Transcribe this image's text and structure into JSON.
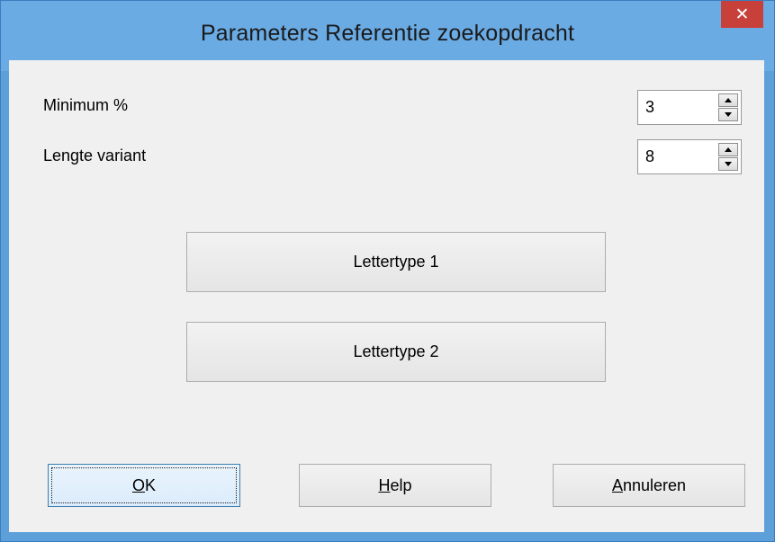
{
  "window": {
    "title": "Parameters Referentie zoekopdracht",
    "close_icon": "close-icon",
    "close_glyph": "✕",
    "accent_color": "#6aabe4",
    "close_color": "#c7403a"
  },
  "fields": {
    "minimum": {
      "label": "Minimum %",
      "value": "3"
    },
    "lengte": {
      "label": "Lengte variant",
      "value": "8"
    }
  },
  "font_buttons": {
    "font1": "Lettertype 1",
    "font2": "Lettertype 2"
  },
  "footer": {
    "ok": {
      "mnemonic": "O",
      "rest": "K"
    },
    "help": {
      "mnemonic": "H",
      "rest": "elp"
    },
    "cancel": {
      "mnemonic": "A",
      "rest": "nnuleren"
    }
  }
}
